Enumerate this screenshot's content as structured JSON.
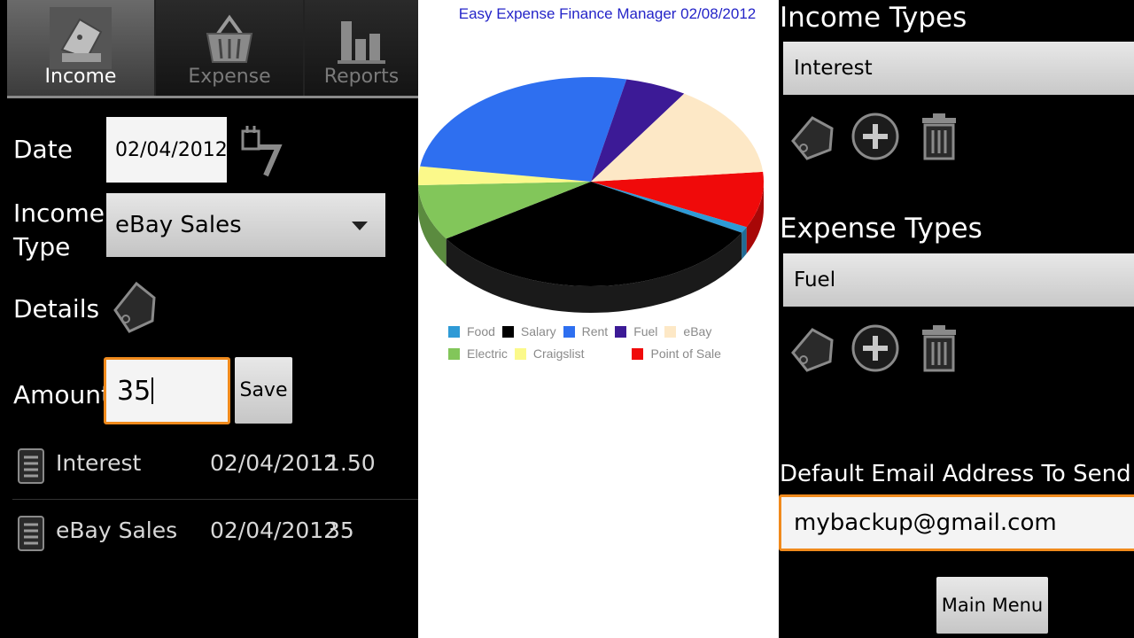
{
  "left": {
    "tabs": [
      {
        "label": "Income",
        "icon": "wallet-icon",
        "selected": true
      },
      {
        "label": "Expense",
        "icon": "basket-icon",
        "selected": false
      },
      {
        "label": "Reports",
        "icon": "bar-chart-icon",
        "selected": false
      }
    ],
    "form": {
      "date_label": "Date",
      "date_value": "02/04/2012",
      "income_type_label_1": "Income",
      "income_type_label_2": "Type",
      "income_type_value": "eBay Sales",
      "details_label": "Details",
      "amount_label": "Amount",
      "amount_value": "35",
      "save_label": "Save"
    },
    "entries": [
      {
        "name": "Interest",
        "date": "02/04/2012",
        "amount": "1.50"
      },
      {
        "name": "eBay Sales",
        "date": "02/04/2012",
        "amount": "35"
      }
    ]
  },
  "middle": {
    "chart_data": {
      "type": "pie",
      "title": "Easy Expense Finance Manager 02/08/2012",
      "legend_position": "bottom",
      "categories": [
        "Food",
        "Salary",
        "Rent",
        "Fuel",
        "eBay",
        "Electric",
        "Craigslist",
        "Point of Sale"
      ],
      "values": [
        1,
        34,
        27,
        6,
        15,
        9,
        3,
        9
      ],
      "colors": [
        "#2e9ad6",
        "#000000",
        "#2e6ff0",
        "#3c1a96",
        "#fde8c6",
        "#82c65a",
        "#fbf98a",
        "#f00a0a"
      ]
    }
  },
  "right": {
    "income_types_heading": "Income Types",
    "income_type_selected": "Interest",
    "expense_types_heading": "Expense Types",
    "expense_type_selected": "Fuel",
    "email_label": "Default Email Address To Send Re",
    "email_value": "mybackup@gmail.com",
    "main_menu_label": "Main Menu"
  }
}
